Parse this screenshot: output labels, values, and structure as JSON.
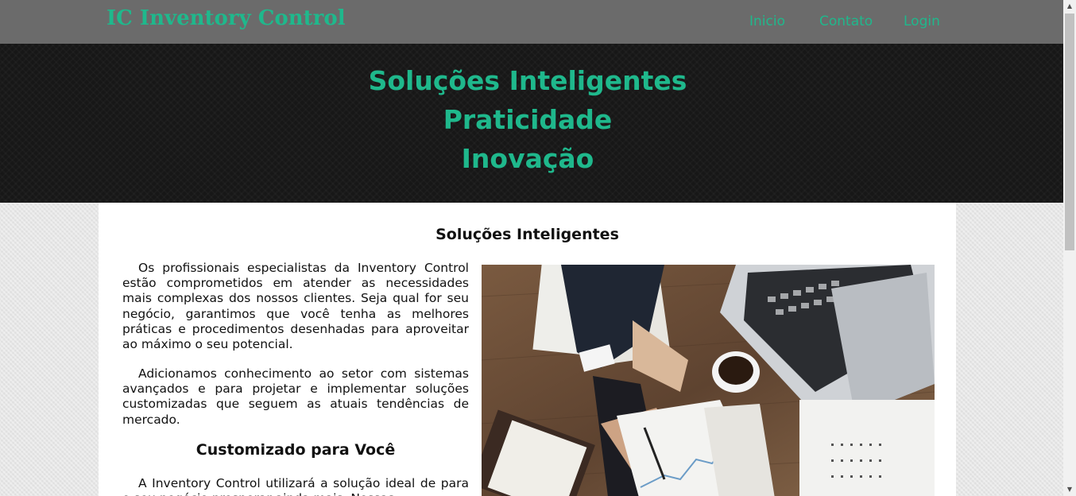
{
  "navbar": {
    "brand": "IC Inventory Control",
    "links": [
      "Inicio",
      "Contato",
      "Login"
    ]
  },
  "hero": {
    "lines": [
      "Soluções Inteligentes",
      "Praticidade",
      "Inovação"
    ]
  },
  "main": {
    "section_title": "Soluções Inteligentes",
    "paragraphs": [
      "Os profissionais especialistas da Inventory Control estão comprometidos em atender as necessidades mais complexas dos nossos clientes. Seja qual for seu negócio, garantimos que você tenha as melhores práticas e procedimentos desenhadas para aproveitar ao máximo o seu potencial.",
      "Adicionamos conhecimento ao setor com sistemas avançados e para projetar e implementar soluções customizadas que seguem as atuais tendências de mercado."
    ],
    "sub_title": "Customizado para Você",
    "sub_paragraph": "A Inventory Control utilizará a solução ideal de para o seu negócio prosperar ainda mais. Nossas",
    "photo_icon": "business-desk-photo"
  },
  "colors": {
    "accent": "#1fb88c",
    "navbar": "#6b6b6b",
    "hero": "#171717"
  },
  "scrollbar": {
    "up_icon": "▲",
    "down_icon": "▼"
  }
}
